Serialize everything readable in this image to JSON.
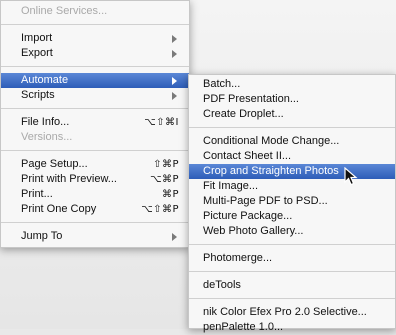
{
  "main_menu": {
    "items": [
      {
        "label": "Online Services...",
        "disabled": true
      },
      {
        "type": "separator"
      },
      {
        "label": "Import",
        "submenu": true
      },
      {
        "label": "Export",
        "submenu": true
      },
      {
        "type": "separator"
      },
      {
        "label": "Automate",
        "submenu": true,
        "highlight": true
      },
      {
        "label": "Scripts",
        "submenu": true
      },
      {
        "type": "separator"
      },
      {
        "label": "File Info...",
        "shortcut": "⌥⇧⌘I"
      },
      {
        "label": "Versions...",
        "disabled": true
      },
      {
        "type": "separator"
      },
      {
        "label": "Page Setup...",
        "shortcut": "⇧⌘P"
      },
      {
        "label": "Print with Preview...",
        "shortcut": "⌥⌘P"
      },
      {
        "label": "Print...",
        "shortcut": "⌘P"
      },
      {
        "label": "Print One Copy",
        "shortcut": "⌥⇧⌘P"
      },
      {
        "type": "separator"
      },
      {
        "label": "Jump To",
        "submenu": true
      }
    ]
  },
  "automate_submenu": {
    "items": [
      {
        "label": "Batch..."
      },
      {
        "label": "PDF Presentation..."
      },
      {
        "label": "Create Droplet..."
      },
      {
        "type": "separator"
      },
      {
        "label": "Conditional Mode Change..."
      },
      {
        "label": "Contact Sheet II..."
      },
      {
        "label": "Crop and Straighten Photos",
        "highlight": true
      },
      {
        "label": "Fit Image..."
      },
      {
        "label": "Multi-Page PDF to PSD..."
      },
      {
        "label": "Picture Package..."
      },
      {
        "label": "Web Photo Gallery..."
      },
      {
        "type": "separator"
      },
      {
        "label": "Photomerge..."
      },
      {
        "type": "separator"
      },
      {
        "label": "deTools"
      },
      {
        "type": "separator"
      },
      {
        "label": "nik Color Efex Pro 2.0 Selective..."
      },
      {
        "label": "penPalette 1.0..."
      }
    ]
  },
  "colors": {
    "highlight": "#2d5db8",
    "menu_bg": "#f7f7f7",
    "disabled_text": "#a9a9a9"
  },
  "icons": {
    "cursor": "arrow-cursor-icon",
    "submenu": "submenu-arrow-icon"
  }
}
